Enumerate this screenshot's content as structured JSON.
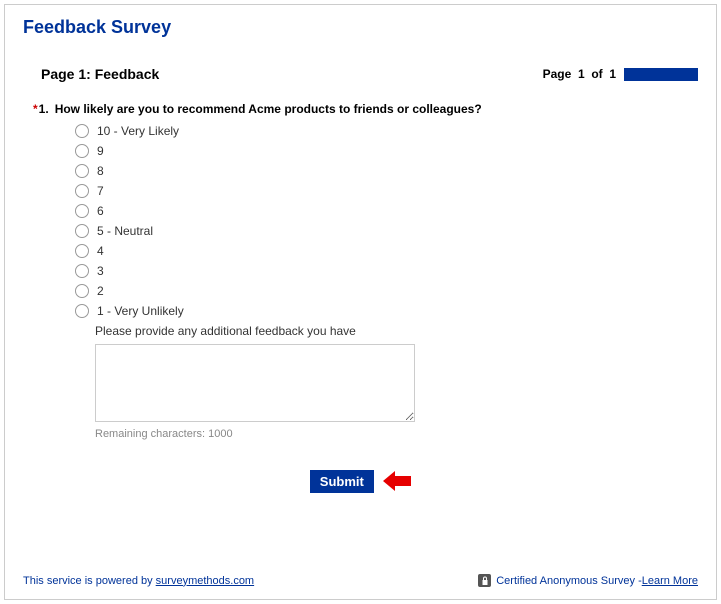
{
  "header": {
    "title": "Feedback Survey"
  },
  "page": {
    "title": "Page 1: Feedback",
    "indicator_prefix": "Page",
    "current": "1",
    "of_label": "of",
    "total": "1"
  },
  "question": {
    "required": "*",
    "number": "1.",
    "text": "How likely are you to recommend Acme products to friends or colleagues?",
    "options": [
      "10 - Very Likely",
      "9",
      "8",
      "7",
      "6",
      "5 - Neutral",
      "4",
      "3",
      "2",
      "1 - Very Unlikely"
    ]
  },
  "feedback": {
    "label": "Please provide any additional feedback you have",
    "remaining": "Remaining characters: 1000"
  },
  "submit": {
    "label": "Submit"
  },
  "footer": {
    "powered_prefix": "This service is powered by ",
    "powered_link": "surveymethods.com",
    "cert_text": "Certified Anonymous Survey - ",
    "learn_more": "Learn More"
  }
}
